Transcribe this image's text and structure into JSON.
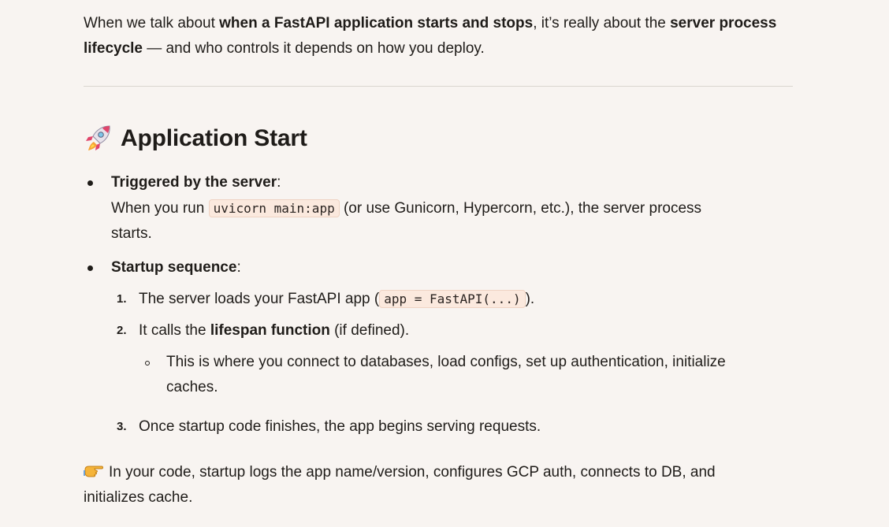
{
  "intro": {
    "part1": "When we talk about ",
    "bold1": "when a FastAPI application starts and stops",
    "part2": ", it’s really about the ",
    "bold2": "server process lifecycle",
    "part3": " — and who controls it depends on how you deploy."
  },
  "section": {
    "icon": "rocket-icon",
    "title": "Application Start"
  },
  "bullets": [
    {
      "label": "Triggered by the server",
      "colon": ":",
      "line1_pre": "When you run ",
      "code": "uvicorn main:app",
      "line1_post": " (or use Gunicorn, Hypercorn, etc.), the server process",
      "line2": "starts."
    },
    {
      "label": "Startup sequence",
      "colon": ":"
    }
  ],
  "steps": [
    {
      "num": "1.",
      "pre": "The server loads your FastAPI app (",
      "code": "app = FastAPI(...)",
      "post": ")."
    },
    {
      "num": "2.",
      "pre": "It calls the ",
      "bold": "lifespan function",
      "post": " (if defined).",
      "sub": {
        "line1": "This is where you connect to databases, load configs, set up authentication, initialize",
        "line2": "caches."
      }
    },
    {
      "num": "3.",
      "text": "Once startup code finishes, the app begins serving requests."
    }
  ],
  "note": {
    "icon": "pointing-hand-icon",
    "line1": "In your code, startup logs the app name/version, configures GCP auth, connects to DB, and",
    "line2": "initializes cache."
  },
  "colors": {
    "background": "#f8f4f1",
    "text": "#1f1c19",
    "code_bg": "#fbe9de",
    "divider": "#dad5d0"
  }
}
